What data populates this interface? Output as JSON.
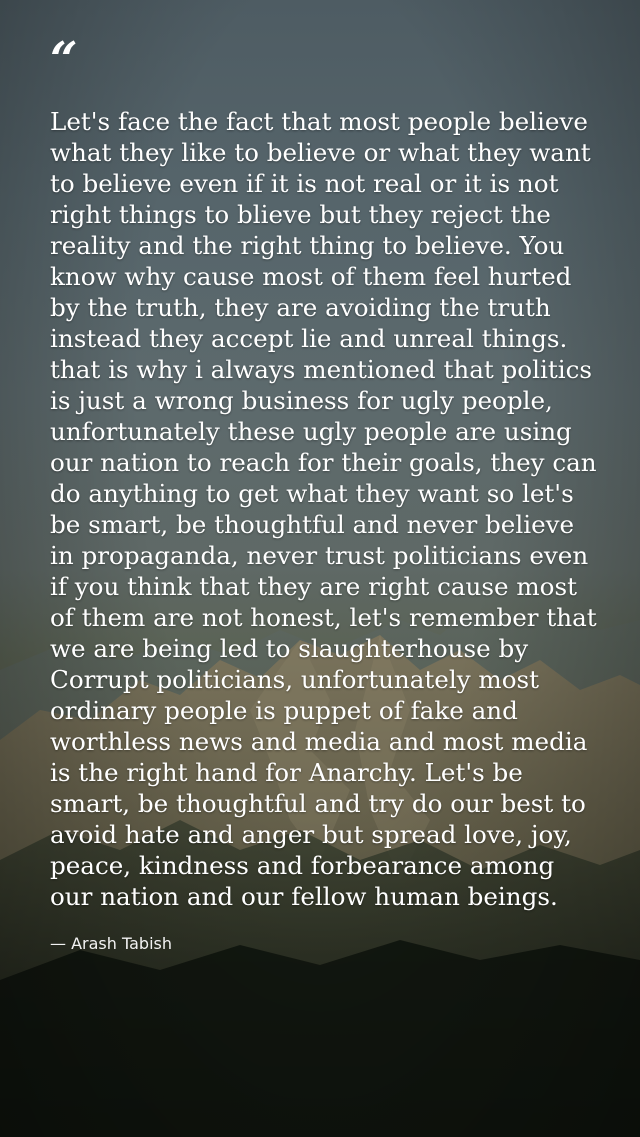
{
  "quote": {
    "mark": "“",
    "text": "Let's face the fact that most people believe what they like to believe or what they want to believe even if it is not real or it is not right things to blieve but they reject the reality and the right thing to believe. You know why cause most of them feel hurted by the truth, they are avoiding the truth instead they accept lie and unreal things. that is why i always mentioned that politics is just a wrong business for ugly people, unfortunately these ugly people are using our nation to reach for their goals, they can do anything to get what they want so let's be smart, be thoughtful and never believe in propaganda, never trust politicians even if you think that they are right cause most of them are not honest, let's remember that we are being led to slaughterhouse by Corrupt politicians, unfortunately most ordinary people is puppet of fake and worthless news and media and most media is the right hand for Anarchy. Let's be smart, be thoughtful and try do our best to avoid hate and anger but spread love, joy, peace, kindness and forbearance among our nation and our fellow human beings.",
    "author": "— Arash Tabish"
  },
  "colors": {
    "text": "#ffffff",
    "sky": "#56656b",
    "mountain": "#6b6650",
    "forest": "#1a2116"
  }
}
